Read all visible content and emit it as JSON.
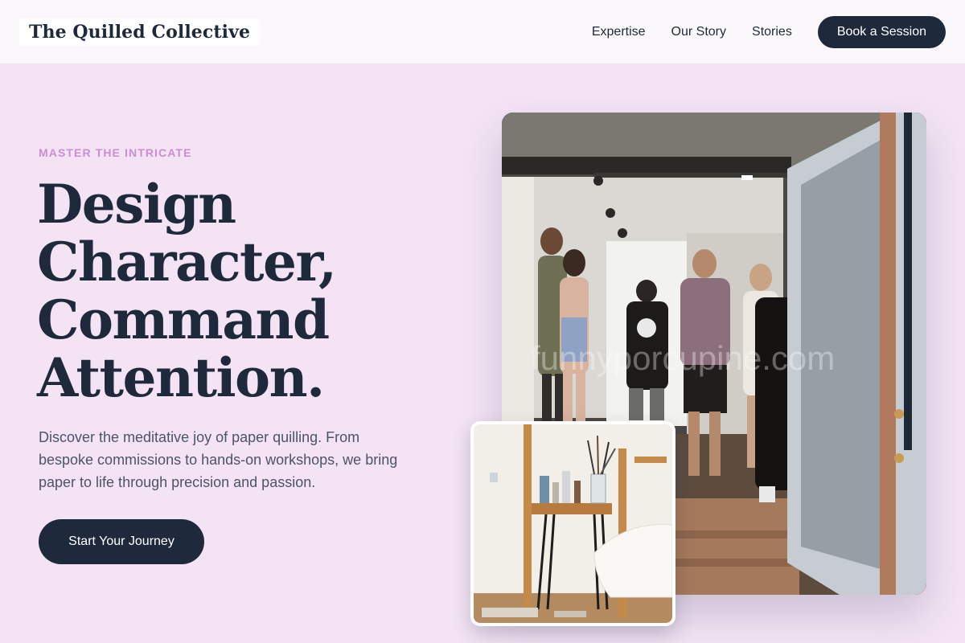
{
  "header": {
    "logo": "The Quilled Collective",
    "nav": [
      "Expertise",
      "Our Story",
      "Stories"
    ],
    "cta": "Book a Session"
  },
  "hero": {
    "eyebrow": "MASTER THE INTRICATE",
    "headline_lines": [
      "Design",
      "Character,",
      "Command",
      "Attention."
    ],
    "lede": "Discover the meditative joy of paper quilling. From bespoke commissions to hands-on workshops, we bring paper to life through precision and passion.",
    "cta": "Start Your Journey"
  },
  "images": {
    "main_watermark": "funnyporcupine.com"
  },
  "colors": {
    "page_background": "#f3e3f5",
    "navy": "#1e293b",
    "eyebrow": "#c98ed4"
  }
}
